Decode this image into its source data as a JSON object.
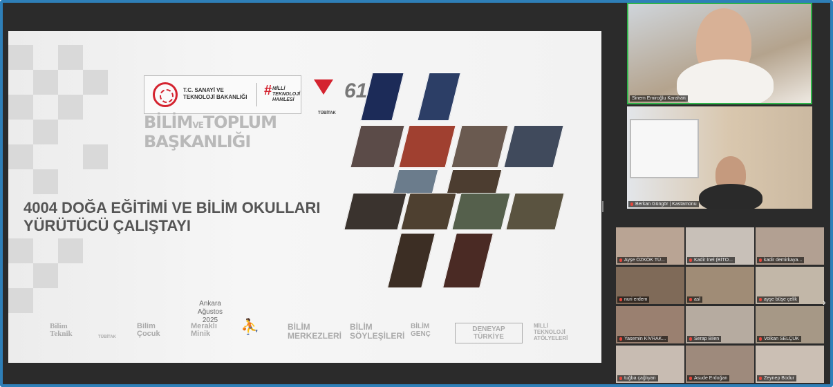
{
  "slide": {
    "ministry_name": "T.C. SANAYİ VE TEKNOLOJİ BAKANLIĞI",
    "mtl_hash": "#",
    "mtl_text": "MİLLİ TEKNOLOJİ HAMLESİ",
    "tubitak_label": "TÜBİTAK",
    "sixty_logo": "61",
    "org_line1": "BİLİM",
    "org_ve": "VE",
    "org_line1b": "TOPLUM",
    "org_line2": "BAŞKANLIĞI",
    "title_line1": "4004 DOĞA EĞİTİMİ VE BİLİM OKULLARI",
    "title_line2": "YÜRÜTÜCÜ ÇALIŞTAYI",
    "city": "Ankara",
    "date": "Ağustos 2025",
    "sponsors": [
      "Bilim Teknik",
      "TÜBİTAK",
      "Bilim Çocuk",
      "Meraklı Minik",
      "",
      "BİLİM MERKEZLERİ",
      "BİLİM SÖYLEŞİLERİ",
      "BİLİM GENÇ",
      "DENEYAP TÜRKİYE",
      "MİLLİ TEKNOLOJİ ATÖLYELERİ"
    ]
  },
  "participants": {
    "speaker": "Sinem Emiroğlu Karahan",
    "second": "Berkan Güngör | Kastamonu",
    "grid": [
      "Ayşe ÖZKÖK TÜ...",
      "Kadir İnel (BİTO...",
      "kadir demirkaya...",
      "nuri erdem",
      "asl",
      "ayşe büşe çelik",
      "Yasemin KIVRAK...",
      "Serap Bilen",
      "Volkan SELÇUK",
      "tuğba çağlıyan",
      "Asude Erdoğan",
      "Zeynep Bodur"
    ]
  },
  "icons": {
    "next_page": "›"
  }
}
